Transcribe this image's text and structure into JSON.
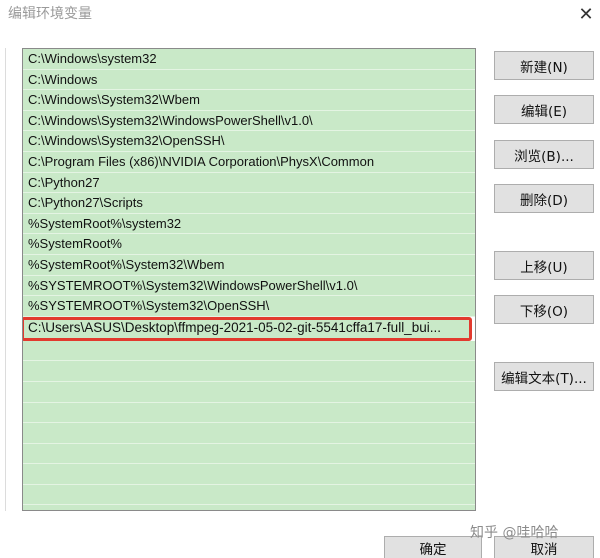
{
  "window": {
    "title": "编辑环境变量",
    "close_glyph": "✕"
  },
  "path_list": [
    "C:\\Windows\\system32",
    "C:\\Windows",
    "C:\\Windows\\System32\\Wbem",
    "C:\\Windows\\System32\\WindowsPowerShell\\v1.0\\",
    "C:\\Windows\\System32\\OpenSSH\\",
    "C:\\Program Files (x86)\\NVIDIA Corporation\\PhysX\\Common",
    "C:\\Python27",
    "C:\\Python27\\Scripts",
    "%SystemRoot%\\system32",
    "%SystemRoot%",
    "%SystemRoot%\\System32\\Wbem",
    "%SYSTEMROOT%\\System32\\WindowsPowerShell\\v1.0\\",
    "%SYSTEMROOT%\\System32\\OpenSSH\\",
    "C:\\Users\\ASUS\\Desktop\\ffmpeg-2021-05-02-git-5541cffa17-full_bui..."
  ],
  "buttons": {
    "new": "新建(N)",
    "edit": "编辑(E)",
    "browse": "浏览(B)...",
    "delete": "删除(D)",
    "move_up": "上移(U)",
    "move_down": "下移(O)",
    "edit_text": "编辑文本(T)...",
    "ok": "确定",
    "cancel": "取消"
  },
  "watermark": "知乎 @哇哈哈",
  "colors": {
    "row_bg": "#c9e9c8",
    "highlight_border": "#e23a2e",
    "button_bg": "#e1e1e1"
  }
}
